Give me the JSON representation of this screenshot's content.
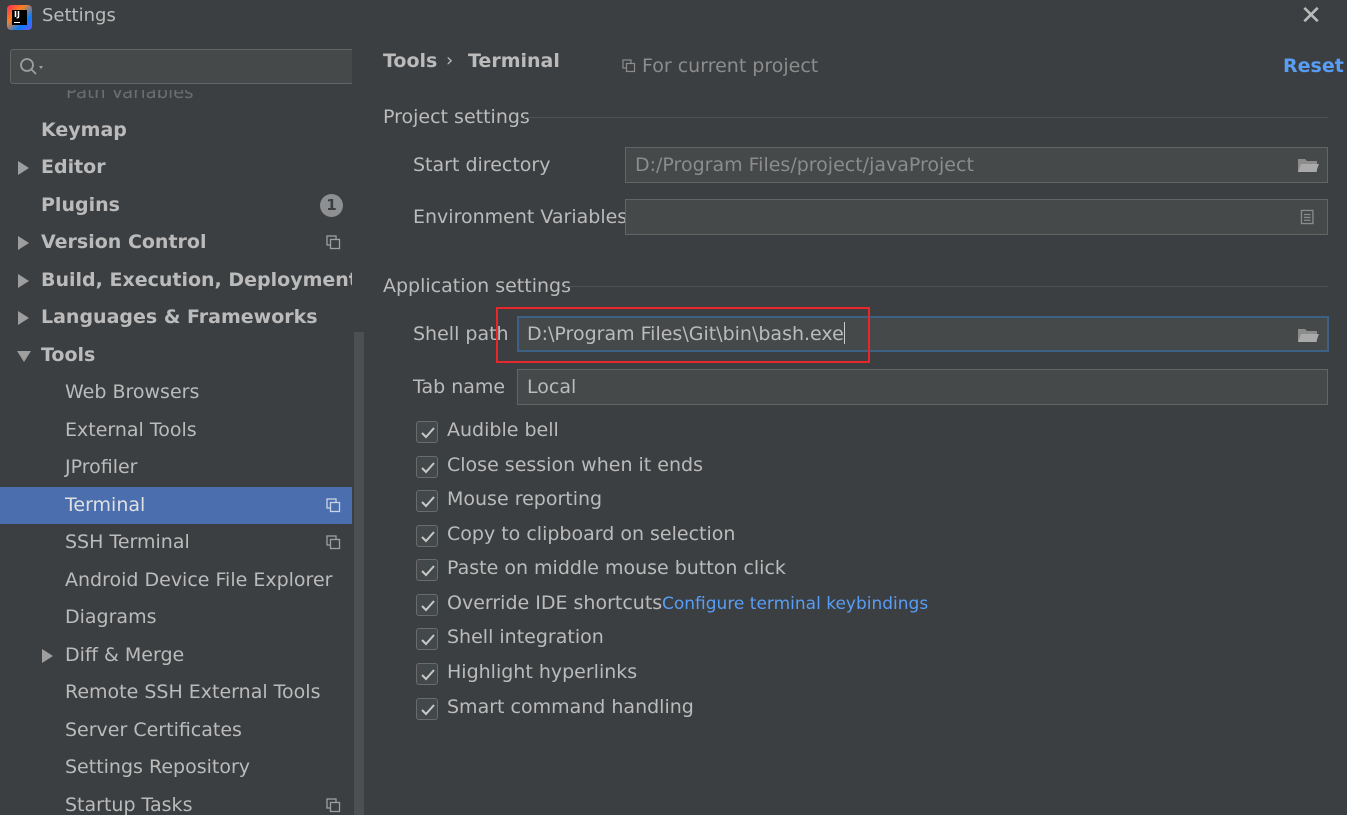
{
  "window": {
    "title": "Settings"
  },
  "sidebar": {
    "search": {
      "value": "",
      "placeholder": ""
    },
    "faded_item": "Path Variables",
    "items": [
      {
        "label": "Keymap"
      },
      {
        "label": "Editor"
      },
      {
        "label": "Plugins",
        "badge": "1"
      },
      {
        "label": "Version Control"
      },
      {
        "label": "Build, Execution, Deployment"
      },
      {
        "label": "Languages & Frameworks"
      },
      {
        "label": "Tools"
      },
      {
        "label": "Web Browsers"
      },
      {
        "label": "External Tools"
      },
      {
        "label": "JProfiler"
      },
      {
        "label": "Terminal"
      },
      {
        "label": "SSH Terminal"
      },
      {
        "label": "Android Device File Explorer"
      },
      {
        "label": "Diagrams"
      },
      {
        "label": "Diff & Merge"
      },
      {
        "label": "Remote SSH External Tools"
      },
      {
        "label": "Server Certificates"
      },
      {
        "label": "Settings Repository"
      },
      {
        "label": "Startup Tasks"
      }
    ]
  },
  "main": {
    "breadcrumb": {
      "parent": "Tools",
      "separator": "›",
      "current": "Terminal"
    },
    "scope": "For current project",
    "reset": "Reset",
    "project_settings": {
      "title": "Project settings",
      "start_directory": {
        "label": "Start directory",
        "value": "D:/Program Files/project/javaProject"
      },
      "env_vars": {
        "label": "Environment Variables",
        "value": ""
      }
    },
    "application_settings": {
      "title": "Application settings",
      "shell_path": {
        "label": "Shell path",
        "value": "D:\\Program Files\\Git\\bin\\bash.exe"
      },
      "tab_name": {
        "label": "Tab name",
        "value": "Local"
      },
      "checkboxes": [
        {
          "label": "Audible bell",
          "checked": true
        },
        {
          "label": "Close session when it ends",
          "checked": true
        },
        {
          "label": "Mouse reporting",
          "checked": true
        },
        {
          "label": "Copy to clipboard on selection",
          "checked": true
        },
        {
          "label": "Paste on middle mouse button click",
          "checked": true
        },
        {
          "label": "Override IDE shortcuts",
          "checked": true
        },
        {
          "label": "Shell integration",
          "checked": true
        },
        {
          "label": "Highlight hyperlinks",
          "checked": true
        },
        {
          "label": "Smart command handling",
          "checked": true
        }
      ],
      "keybindings_link": "Configure terminal keybindings"
    }
  },
  "colors": {
    "background": "#3c3f41",
    "selection": "#4b6eaf",
    "link": "#589df6",
    "highlight_border": "#e8262b"
  },
  "icons": [
    "app-logo-icon",
    "close-icon",
    "search-icon",
    "copy-icon",
    "folder-icon",
    "list-icon",
    "check-icon"
  ]
}
